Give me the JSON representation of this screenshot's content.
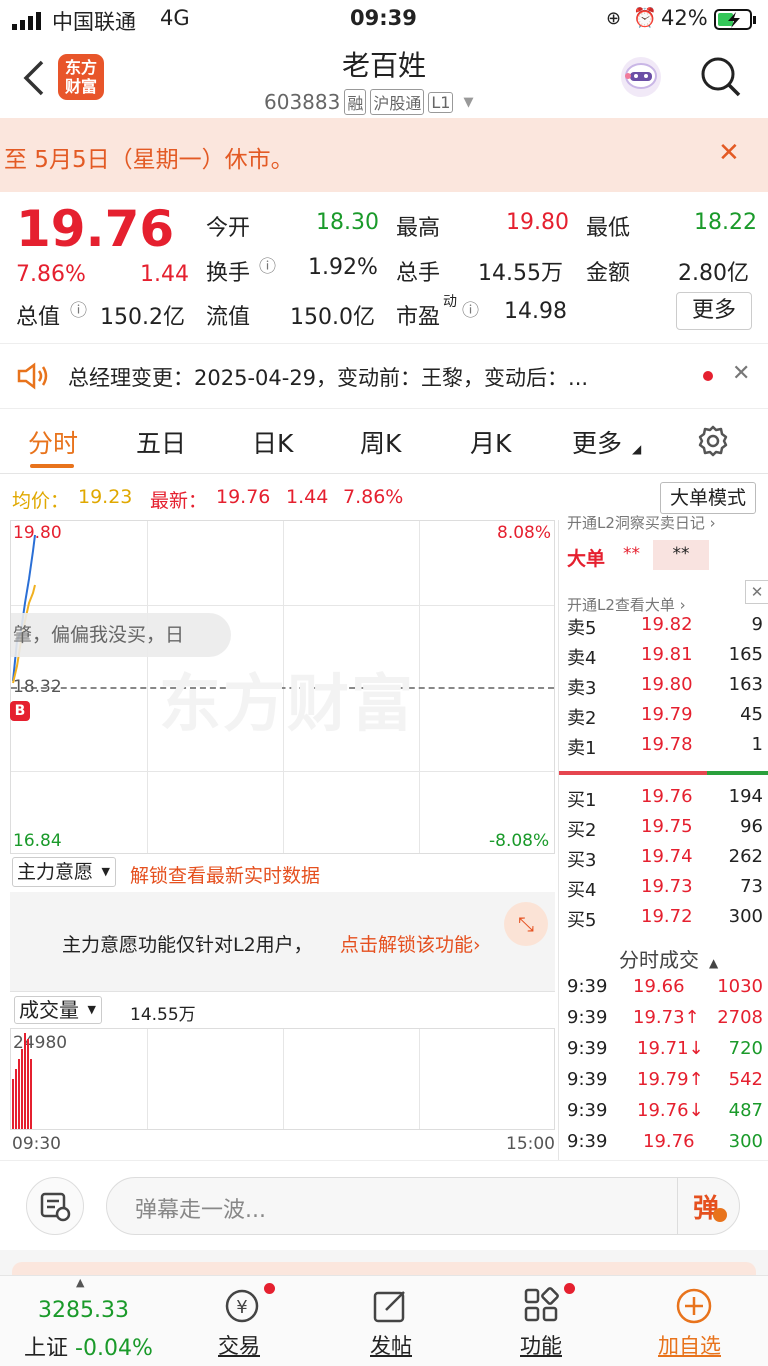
{
  "status": {
    "carrier": "中国联通",
    "network": "4G",
    "time": "09:39",
    "battery": "42%"
  },
  "header": {
    "title": "老百姓",
    "code": "603883",
    "tags": [
      "融",
      "沪股通",
      "L1"
    ],
    "logo": "东方\n财富"
  },
  "notice": {
    "text": "至 5月5日（星期一）休市。",
    "close": "✕"
  },
  "quote": {
    "price": "19.76",
    "pct": "7.86%",
    "change": "1.44",
    "items": [
      {
        "label": "今开",
        "value": "18.30",
        "color": "green"
      },
      {
        "label": "最高",
        "value": "19.80",
        "color": "red"
      },
      {
        "label": "最低",
        "value": "18.22",
        "color": "green"
      },
      {
        "label": "换手",
        "value": "1.92%",
        "color": "dark"
      },
      {
        "label": "总手",
        "value": "14.55万",
        "color": "dark"
      },
      {
        "label": "金额",
        "value": "2.80亿",
        "color": "dark"
      },
      {
        "label": "总值",
        "value": "150.2亿",
        "color": "dark"
      },
      {
        "label": "流值",
        "value": "150.0亿",
        "color": "dark"
      },
      {
        "label": "市盈",
        "value": "14.98",
        "color": "dark"
      }
    ],
    "pe_sup": "动",
    "more": "更多"
  },
  "news": {
    "text": "总经理变更：2025-04-29，变动前：王黎，变动后：..."
  },
  "tabs": [
    "分时",
    "五日",
    "日K",
    "周K",
    "月K",
    "更多"
  ],
  "infoline": {
    "avg_label": "均价：",
    "avg": "19.23",
    "latest_label": "最新：",
    "latest": "19.76",
    "chg": "1.44",
    "pct": "7.86%",
    "mode_btn": "大单模式"
  },
  "chart": {
    "top_price": "19.80",
    "top_pct": "8.08%",
    "mid_price": "18.32",
    "bot_price": "16.84",
    "bot_pct": "-8.08%",
    "danmu": "肇，偏偏我没买，日",
    "watermark": "东方财富",
    "b_marker": "B"
  },
  "zhuli": {
    "label": "主力意愿",
    "lock": "解锁查看最新实时数据",
    "msg": "主力意愿功能仅针对L2用户，",
    "link": "点击解锁该功能›"
  },
  "volume": {
    "label": "成交量",
    "total": "14.55万",
    "max": "24980",
    "t_start": "09:30",
    "t_end": "15:00"
  },
  "orderbook": {
    "top_note": "开通L2洞察买卖日记 ›",
    "big": "大单",
    "stars": "**",
    "stars2": "**",
    "l2_note": "开通L2查看大单 ›",
    "sell": [
      {
        "l": "卖5",
        "p": "19.82",
        "v": "9"
      },
      {
        "l": "卖4",
        "p": "19.81",
        "v": "165"
      },
      {
        "l": "卖3",
        "p": "19.80",
        "v": "163"
      },
      {
        "l": "卖2",
        "p": "19.79",
        "v": "45"
      },
      {
        "l": "卖1",
        "p": "19.78",
        "v": "1"
      }
    ],
    "buy": [
      {
        "l": "买1",
        "p": "19.76",
        "v": "194"
      },
      {
        "l": "买2",
        "p": "19.75",
        "v": "96"
      },
      {
        "l": "买3",
        "p": "19.74",
        "v": "262"
      },
      {
        "l": "买4",
        "p": "19.73",
        "v": "73"
      },
      {
        "l": "买5",
        "p": "19.72",
        "v": "300"
      }
    ],
    "trade_title": "分时成交",
    "trades": [
      {
        "t": "9:39",
        "p": "19.66",
        "v": "1030",
        "vc": "red"
      },
      {
        "t": "9:39",
        "p": "19.73↑",
        "v": "2708",
        "vc": "red"
      },
      {
        "t": "9:39",
        "p": "19.71↓",
        "v": "720",
        "vc": "green"
      },
      {
        "t": "9:39",
        "p": "19.79↑",
        "v": "542",
        "vc": "red"
      },
      {
        "t": "9:39",
        "p": "19.76↓",
        "v": "487",
        "vc": "green"
      },
      {
        "t": "9:39",
        "p": "19.76",
        "v": "300",
        "vc": "green"
      }
    ]
  },
  "comment": {
    "placeholder": "弹幕走一波...",
    "btn": "弹"
  },
  "nav": {
    "index_value": "3285.33",
    "index_name": "上证",
    "index_change": "-0.04%",
    "items": [
      "交易",
      "发帖",
      "功能",
      "加自选"
    ]
  }
}
